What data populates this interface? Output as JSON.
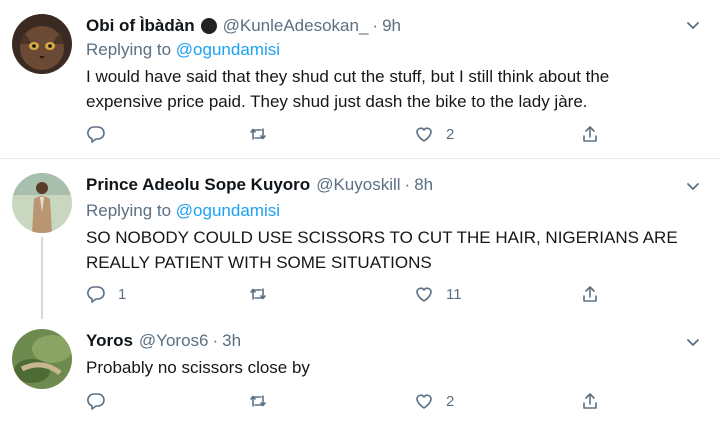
{
  "tweets": [
    {
      "name": "Obi of Ìbàdàn",
      "handle": "@KunleAdesokan_",
      "dot": "·",
      "time": "9h",
      "replying_prefix": "Replying to",
      "replying_to": "@ogundamisi",
      "text": "I would have said that they shud cut the stuff, but I still think about the expensive price paid. They shud just dash the bike to the lady jàre.",
      "reply_count": "",
      "retweet_count": "",
      "like_count": "2"
    },
    {
      "name": "Prince Adeolu Sope Kuyoro",
      "handle": "@Kuyoskill",
      "dot": "·",
      "time": "8h",
      "replying_prefix": "Replying to",
      "replying_to": "@ogundamisi",
      "text": "SO NOBODY COULD USE SCISSORS TO CUT THE HAIR, NIGERIANS ARE REALLY PATIENT WITH SOME SITUATIONS",
      "reply_count": "1",
      "retweet_count": "",
      "like_count": "11"
    },
    {
      "name": "Yoros",
      "handle": "@Yoros6",
      "dot": "·",
      "time": "3h",
      "text": "Probably no scissors close by",
      "reply_count": "",
      "retweet_count": "",
      "like_count": "2"
    }
  ],
  "colors": {
    "accent": "#1da1f2",
    "muted": "#5b7083",
    "divider": "#e6ecf0"
  },
  "icons": [
    "reply-icon",
    "retweet-icon",
    "like-icon",
    "share-icon",
    "chevron-down-icon",
    "verified-badge-icon"
  ]
}
